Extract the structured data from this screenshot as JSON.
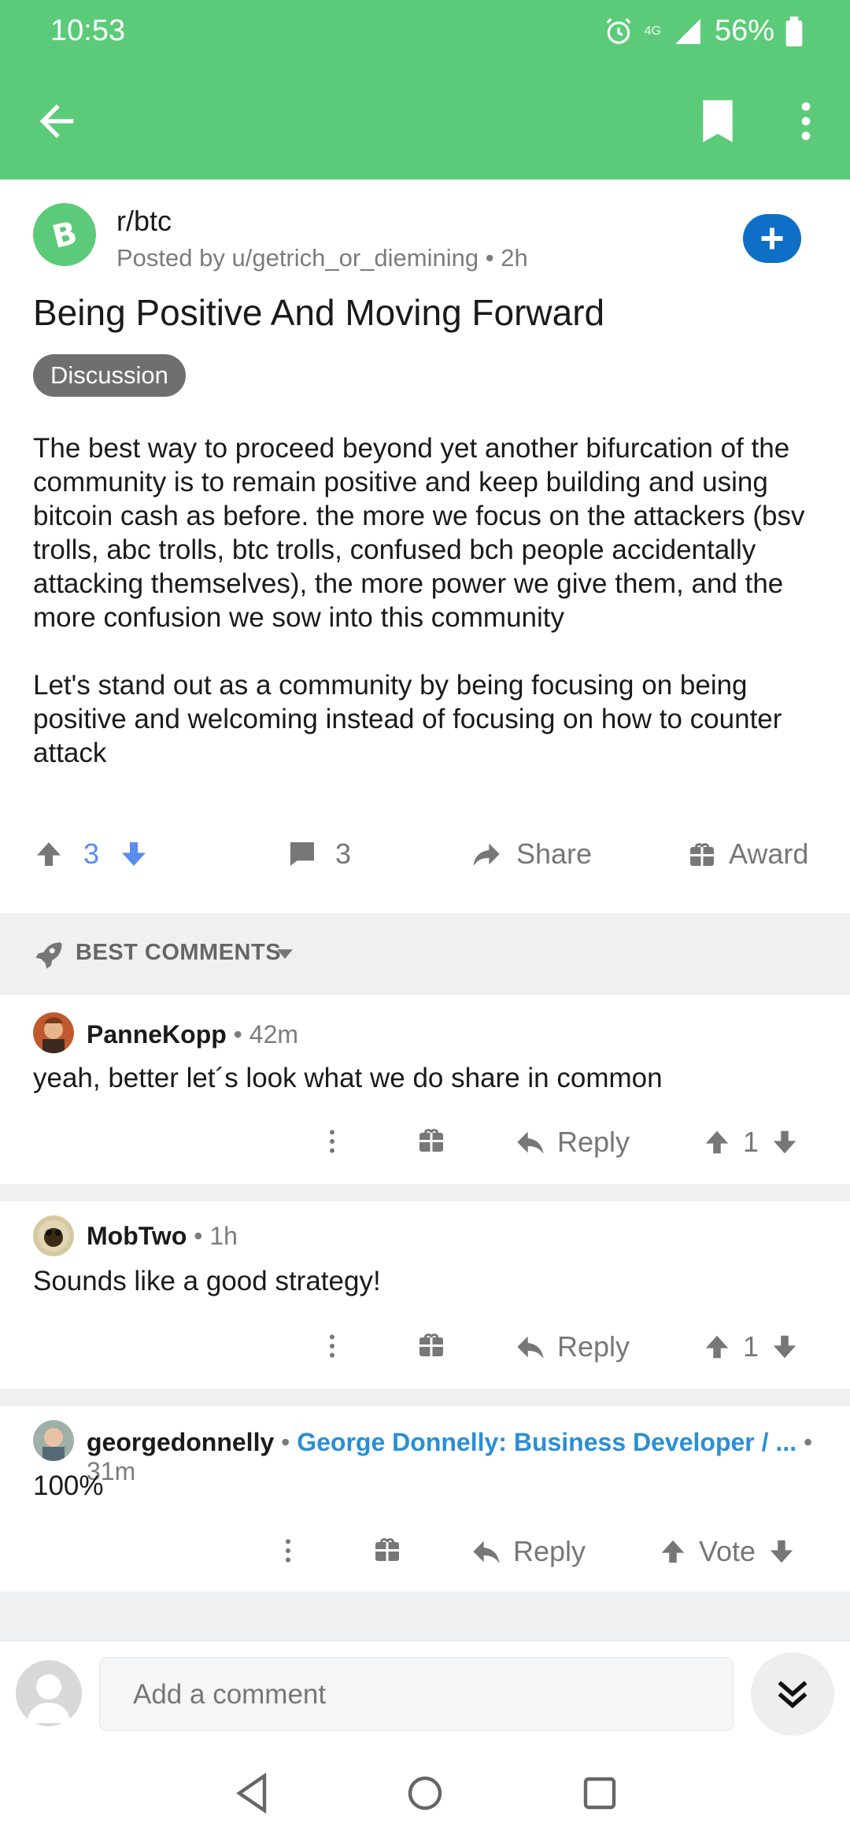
{
  "status_bar": {
    "time": "10:53",
    "network": "4G",
    "battery": "56%"
  },
  "toolbar": {
    "back_icon": "arrow-left-icon",
    "bookmark_icon": "bookmark-icon",
    "more_icon": "more-vertical-icon"
  },
  "post": {
    "subreddit": "r/btc",
    "posted_by": "Posted by u/getrich_or_diemining",
    "age": "2h",
    "title": "Being Positive And Moving Forward",
    "flair": "Discussion",
    "paragraphs": [
      "The best way to proceed beyond yet another bifurcation of the community is to remain positive and keep building and using bitcoin cash as before. the more we focus on the attackers (bsv trolls, abc trolls, btc trolls, confused bch people accidentally attacking themselves), the more power we give them, and the more confusion we sow into this community",
      "Let's stand out as a community by being focusing on being positive and welcoming instead of focusing on how to counter attack"
    ],
    "score": "3",
    "comment_count": "3",
    "share_label": "Share",
    "award_label": "Award"
  },
  "comments_header": {
    "label": "BEST COMMENTS"
  },
  "comments": [
    {
      "author": "PanneKopp",
      "age": "42m",
      "text": "yeah, better let´s look what we do share in common",
      "reply_label": "Reply",
      "score": "1"
    },
    {
      "author": "MobTwo",
      "age": "1h",
      "text": "Sounds like a good strategy!",
      "reply_label": "Reply",
      "score": "1"
    },
    {
      "author": "georgedonnelly",
      "flair": "George Donnelly: Business Developer / ...",
      "age": "31m",
      "text": "100%",
      "reply_label": "Reply",
      "score": "Vote"
    }
  ],
  "composer": {
    "placeholder": "Add a comment"
  },
  "colors": {
    "brand": "#5ccb79",
    "join": "#0f6fc6",
    "upvoted": "#5a8cf0",
    "flair_link": "#2a8fd4"
  }
}
